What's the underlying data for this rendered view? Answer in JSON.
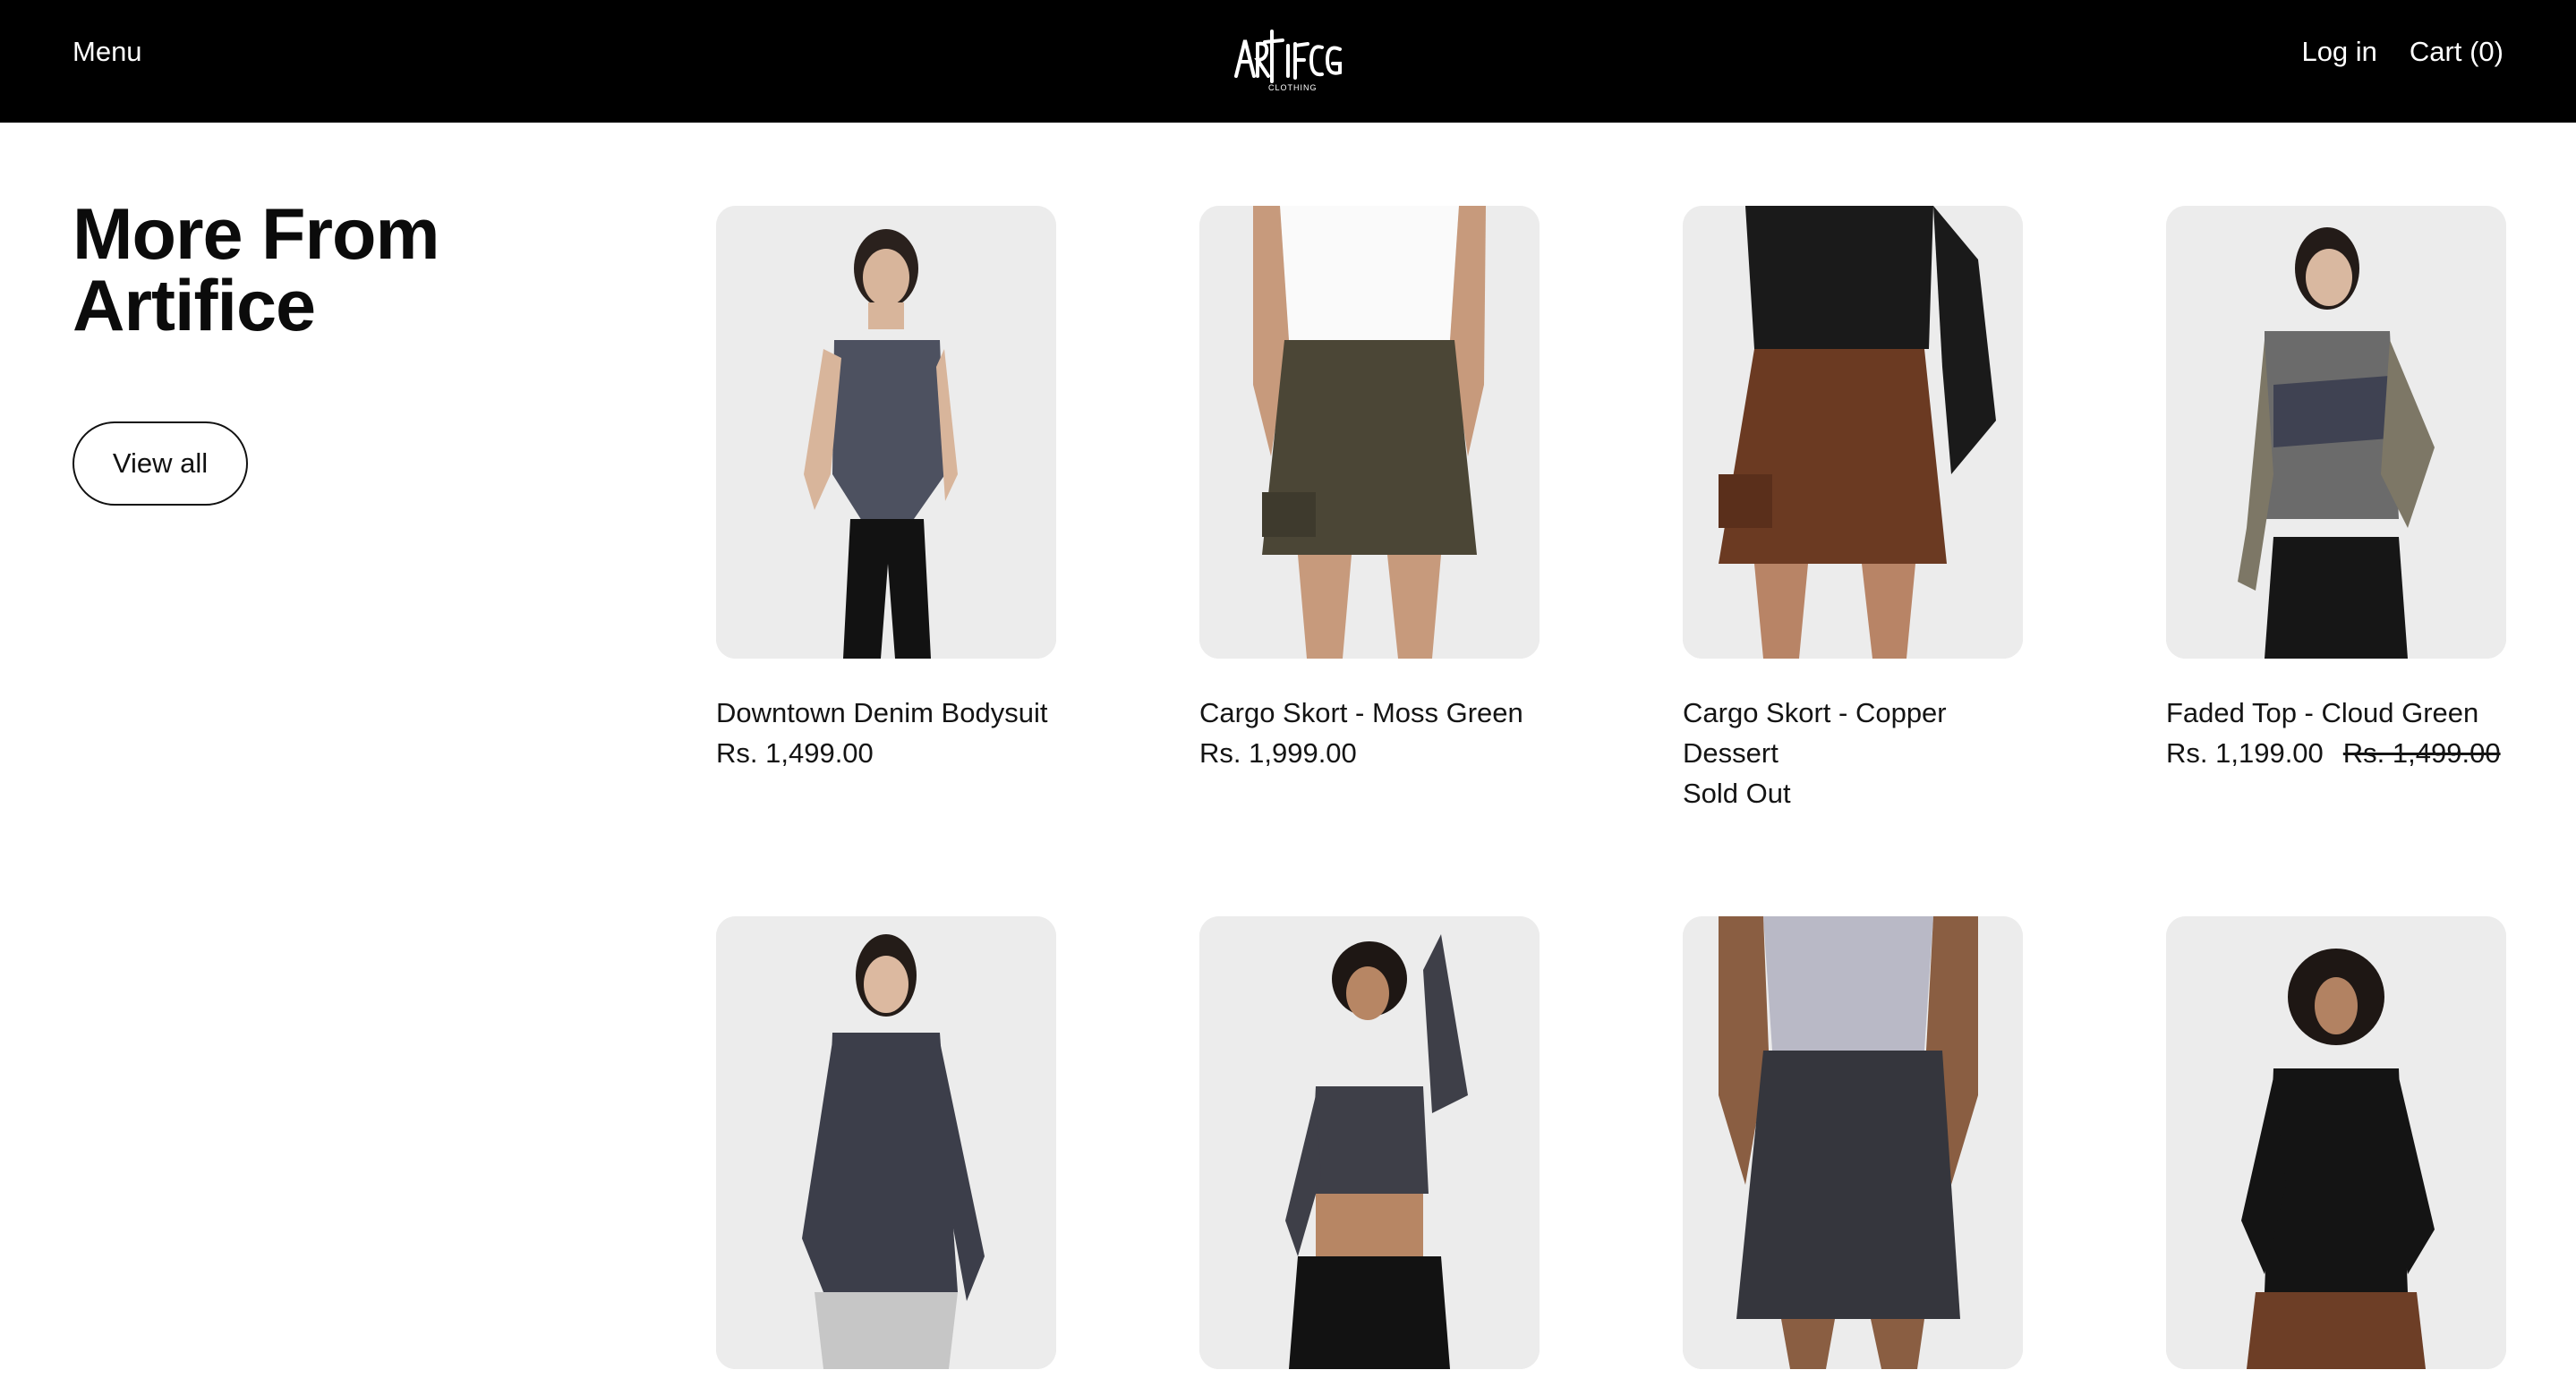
{
  "header": {
    "menu_label": "Menu",
    "brand_logo_text": "ARTIFICE",
    "login_label": "Log in",
    "cart_label": "Cart (0)"
  },
  "section": {
    "title": "More From\nArtifice",
    "view_all_label": "View all"
  },
  "products": [
    {
      "name": "Downtown Denim Bodysuit",
      "price": "Rs. 1,499.00",
      "compare_price": "",
      "status": ""
    },
    {
      "name": "Cargo Skort - Moss Green",
      "price": "Rs. 1,999.00",
      "compare_price": "",
      "status": ""
    },
    {
      "name": "Cargo Skort - Copper Dessert",
      "price": "",
      "compare_price": "",
      "status": "Sold Out"
    },
    {
      "name": "Faded Top - Cloud Green",
      "price": "Rs. 1,199.00",
      "compare_price": "Rs. 1,499.00",
      "status": ""
    },
    {
      "name": "",
      "price": "",
      "compare_price": "",
      "status": ""
    },
    {
      "name": "",
      "price": "",
      "compare_price": "",
      "status": ""
    },
    {
      "name": "",
      "price": "",
      "compare_price": "",
      "status": ""
    },
    {
      "name": "",
      "price": "",
      "compare_price": "",
      "status": ""
    }
  ],
  "colors": {
    "header_bg": "#000000",
    "text": "#111111",
    "card_bg": "#e8e8e8"
  }
}
